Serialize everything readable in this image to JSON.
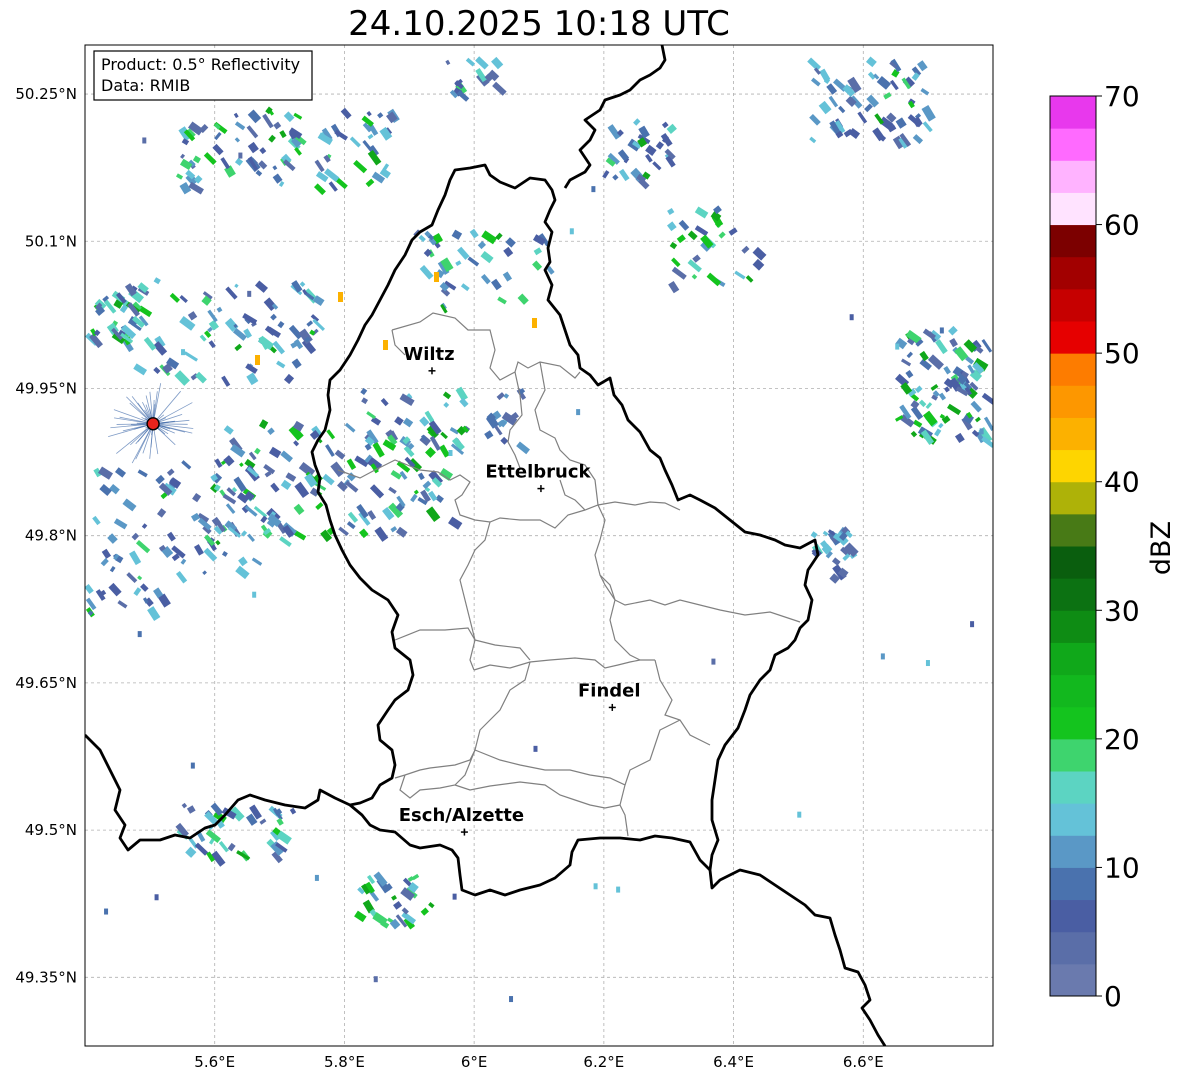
{
  "title": "24.10.2025 10:18 UTC",
  "infobox": {
    "product": "Product: 0.5° Reflectivity",
    "data": "Data: RMIB"
  },
  "map": {
    "lon_range": [
      5.4,
      6.8
    ],
    "lat_range": [
      49.28,
      50.3
    ],
    "x_ticks": [
      "5.6°E",
      "5.8°E",
      "6°E",
      "6.2°E",
      "6.4°E",
      "6.6°E"
    ],
    "x_tick_values": [
      5.6,
      5.8,
      6.0,
      6.2,
      6.4,
      6.6
    ],
    "y_ticks": [
      "50.25°N",
      "50.1°N",
      "49.95°N",
      "49.8°N",
      "49.65°N",
      "49.5°N",
      "49.35°N"
    ],
    "y_tick_values": [
      50.25,
      50.1,
      49.95,
      49.8,
      49.65,
      49.5,
      49.35
    ],
    "gridlines": true,
    "cities": [
      {
        "name": "Wiltz",
        "lon": 5.935,
        "lat": 49.968
      },
      {
        "name": "Ettelbruck",
        "lon": 6.103,
        "lat": 49.848
      },
      {
        "name": "Findel",
        "lon": 6.213,
        "lat": 49.625
      },
      {
        "name": "Esch/Alzette",
        "lon": 5.985,
        "lat": 49.498
      }
    ],
    "radar_site": {
      "lon": 5.505,
      "lat": 49.914
    }
  },
  "colorbar": {
    "label": "dBZ",
    "ticks": [
      "0",
      "10",
      "20",
      "30",
      "40",
      "50",
      "60",
      "70"
    ],
    "min": 0,
    "max": 70,
    "step": 2.5,
    "colors": [
      "#6a7aae",
      "#5a6ea8",
      "#4a5ea3",
      "#4a72ae",
      "#5a98c6",
      "#64c2d8",
      "#5cd4c2",
      "#3ed46e",
      "#14c41e",
      "#12b81e",
      "#10a81a",
      "#0e8c14",
      "#0c7212",
      "#0a5e0e",
      "#487a16",
      "#aeb208",
      "#fed500",
      "#fcb100",
      "#fd9700",
      "#fd7c00",
      "#e60000",
      "#c60000",
      "#a20000",
      "#7c0000",
      "#ffe3ff",
      "#ffb3ff",
      "#ff6aff",
      "#e838ed"
    ]
  }
}
